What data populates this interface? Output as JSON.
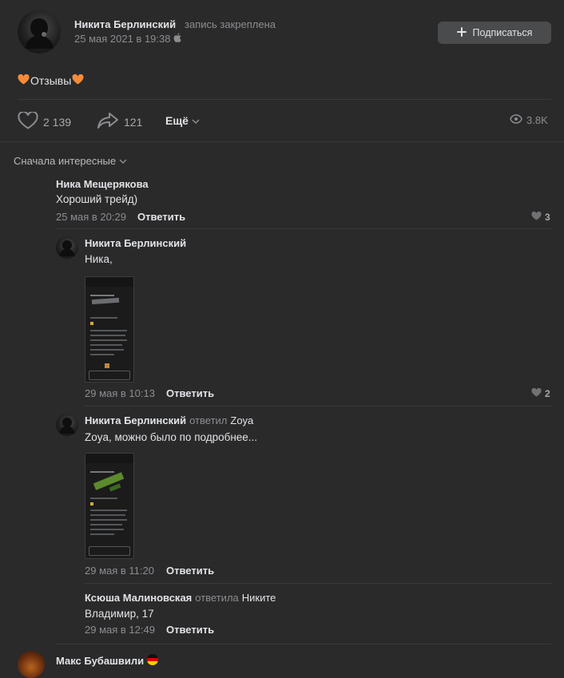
{
  "post": {
    "author": "Никита Берлинский",
    "pinned_label": "запись закреплена",
    "date": "25 мая 2021 в 19:38",
    "subscribe_label": "Подписаться",
    "text": "Отзывы",
    "likes": "2 139",
    "shares": "121",
    "more_label": "Ещё",
    "views": "3.8K"
  },
  "comments": {
    "sort_label": "Сначала интересные",
    "reply_label": "Ответить",
    "items": [
      {
        "author": "Ника Мещерякова",
        "text": "Хороший трейд)",
        "date": "25 мая в 20:29",
        "likes": "3"
      },
      {
        "author": "Никита Берлинский",
        "text": "Ника,",
        "date": "29 мая в 10:13",
        "likes": "2"
      },
      {
        "author": "Никита Берлинский",
        "replied_word": "ответил",
        "replied_to": "Zoya",
        "text": "Zoya, можно было по подробнее...",
        "date": "29 мая в 11:20"
      },
      {
        "author": "Ксюша Малиновская",
        "replied_word": "ответила",
        "replied_to": "Никите",
        "text": "Владимир, 17",
        "date": "29 мая в 12:49"
      },
      {
        "author": "Макс Бубашвили"
      }
    ]
  },
  "colors": {
    "background": "#2a2a2b",
    "text": "#e1e3e6",
    "muted": "#8b8d91",
    "heart_emoji": "#f58b3a",
    "button": "#4a4b4d"
  },
  "icons": [
    "apple-icon",
    "plus-icon",
    "heart-emoji-icon",
    "like-icon",
    "share-icon",
    "chevron-down-icon",
    "views-icon",
    "small-heart-icon",
    "flag-de-icon"
  ]
}
